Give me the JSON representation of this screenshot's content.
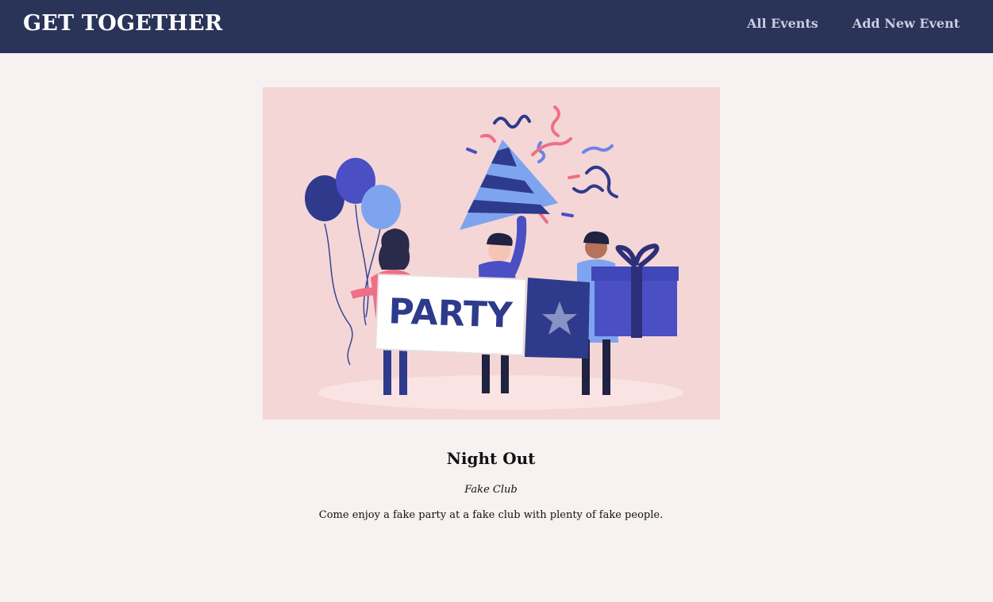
{
  "header": {
    "brand": "GET TOGETHER",
    "nav": [
      {
        "label": "All Events"
      },
      {
        "label": "Add New Event"
      }
    ]
  },
  "event": {
    "image_banner_text": "PARTY",
    "title": "Night Out",
    "venue": "Fake Club",
    "description": "Come enjoy a fake party at a fake club with plenty of fake people."
  },
  "colors": {
    "header_bg": "#2a3358",
    "page_bg": "#f7f1f1",
    "image_bg": "#f4d6d6",
    "accent_navy": "#2e3a8c",
    "accent_blue": "#7fa4ef",
    "accent_pink": "#ee6f86"
  }
}
